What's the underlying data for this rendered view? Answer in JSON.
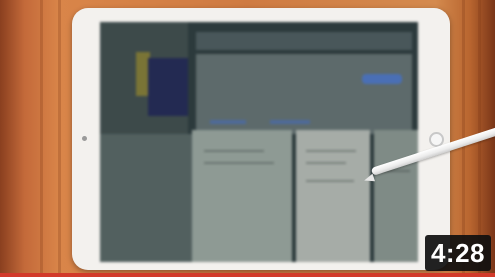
{
  "thumbnail": {
    "duration": "4:28",
    "watched_fraction": 1.0
  },
  "colors": {
    "progress": "#d23a2a",
    "wood": "#cf7b42",
    "ipad_frame": "#f3f1ee",
    "screen_accent_blue": "#4a6fb5"
  },
  "objects": {
    "device": "ipad",
    "stylus": "apple-pencil",
    "background": "wood-surface"
  }
}
